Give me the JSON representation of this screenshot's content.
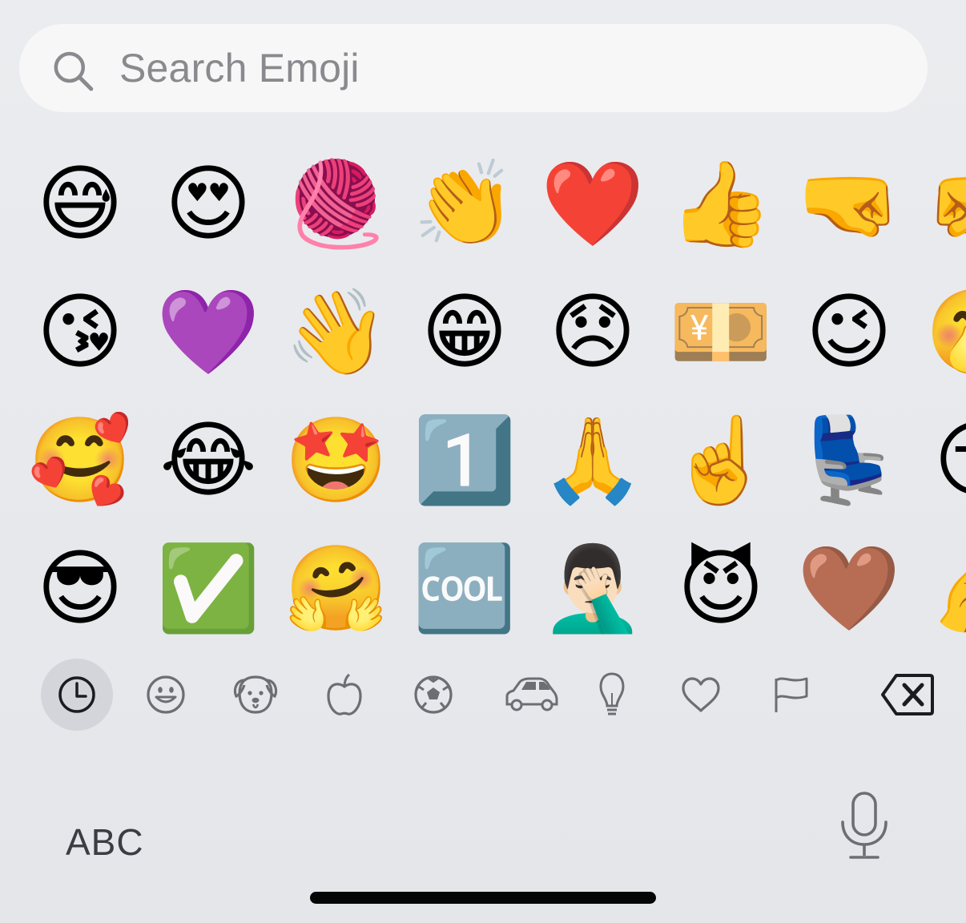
{
  "search": {
    "placeholder": "Search Emoji"
  },
  "emoji_rows": [
    [
      "😅",
      "😍",
      "🧶",
      "👏",
      "❤️",
      "👍",
      "🤜",
      "🤛"
    ],
    [
      "😘",
      "💜",
      "👋",
      "😁",
      "😞",
      "💴",
      "😉",
      "🤭"
    ],
    [
      "🥰",
      "😂",
      "🤩",
      "1️⃣",
      "🙏",
      "☝️",
      "💺",
      "😏"
    ],
    [
      "😎",
      "✅",
      "🤗",
      "🆒",
      "🤦🏻‍♂️",
      "😈",
      "🤎",
      "🤌"
    ]
  ],
  "categories": [
    {
      "name": "recent-clock-icon",
      "active": true
    },
    {
      "name": "smileys-icon",
      "active": false
    },
    {
      "name": "animals-icon",
      "active": false
    },
    {
      "name": "food-apple-icon",
      "active": false
    },
    {
      "name": "activity-soccer-icon",
      "active": false
    },
    {
      "name": "travel-car-icon",
      "active": false
    },
    {
      "name": "objects-lightbulb-icon",
      "active": false
    },
    {
      "name": "symbols-heart-icon",
      "active": false
    },
    {
      "name": "flags-icon",
      "active": false
    }
  ],
  "bottom": {
    "abc_label": "ABC"
  },
  "colors": {
    "background": "#e6e7eb",
    "search_field": "#f7f7f8",
    "icon_gray": "#6d6e73",
    "active_category": "#d3d5db"
  }
}
